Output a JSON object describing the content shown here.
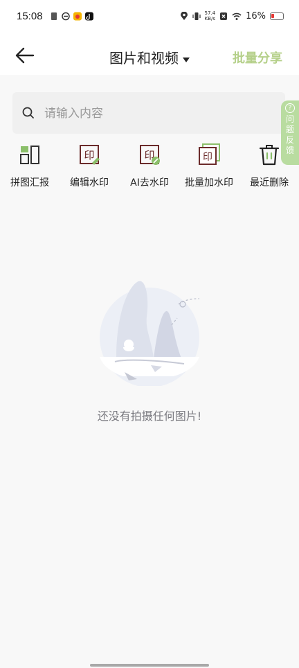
{
  "status_bar": {
    "time": "15:08",
    "net_speed_value": "57.4",
    "net_speed_unit": "KB/s",
    "battery": "16%",
    "battery_color": "#e53935"
  },
  "header": {
    "back_icon": "back-arrow-icon",
    "title": "图片和视频",
    "action": "批量分享",
    "action_color": "#b5d08a"
  },
  "search": {
    "placeholder": "请输入内容",
    "value": ""
  },
  "feedback": {
    "label": "问题反馈",
    "chars": [
      "问",
      "题",
      "反",
      "馈"
    ],
    "color": "#b9dca0"
  },
  "tools": [
    {
      "label": "拼图汇报",
      "icon": "collage-report-icon"
    },
    {
      "label": "编辑水印",
      "icon": "edit-watermark-icon"
    },
    {
      "label": "AI去水印",
      "icon": "ai-remove-watermark-icon"
    },
    {
      "label": "批量加水印",
      "icon": "batch-watermark-icon"
    },
    {
      "label": "最近删除",
      "icon": "trash-icon"
    }
  ],
  "empty_state": {
    "illustration": "mountain-empty-illustration",
    "message": "还没有拍摄任何图片!"
  }
}
